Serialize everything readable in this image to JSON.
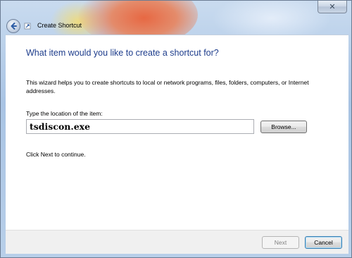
{
  "window": {
    "title": "Create Shortcut",
    "close_glyph": "✕"
  },
  "wizard": {
    "heading": "What item would you like to create a shortcut for?",
    "description": "This wizard helps you to create shortcuts to local or network programs, files, folders, computers, or Internet addresses.",
    "location_label": "Type the location of the item:",
    "location_value": "tsdiscon.exe",
    "browse_label": "Browse...",
    "hint": "Click Next to continue."
  },
  "footer": {
    "next_label": "Next",
    "cancel_label": "Cancel",
    "next_enabled": false
  },
  "icons": {
    "back": "back-arrow-icon",
    "wizard": "shortcut-wizard-icon",
    "close": "close-icon"
  },
  "colors": {
    "heading": "#1e3d8c",
    "title_bar_accent": "#e9623a"
  }
}
